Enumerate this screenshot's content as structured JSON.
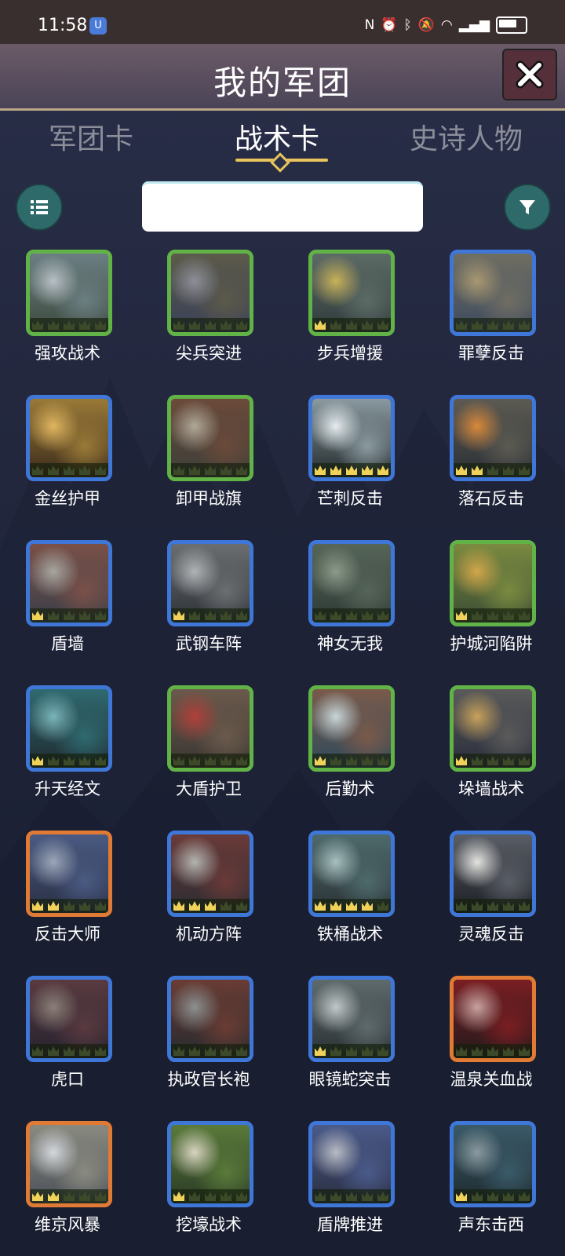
{
  "status": {
    "time": "11:58",
    "app_badge": "U"
  },
  "header": {
    "title": "我的军团"
  },
  "tabs": [
    {
      "label": "军团卡",
      "active": false
    },
    {
      "label": "战术卡",
      "active": true
    },
    {
      "label": "史诗人物",
      "active": false
    }
  ],
  "search": {
    "value": "",
    "placeholder": ""
  },
  "colors": {
    "green": "#62b347",
    "blue": "#3f77d9",
    "orange": "#e07a34",
    "gold": "#e8c45a"
  },
  "cards": [
    {
      "name": "强攻战术",
      "rarity": "green",
      "stars": 0,
      "art": [
        "#3d4b3e",
        "#6b7e82",
        "#b8c0c6"
      ]
    },
    {
      "name": "尖兵突进",
      "rarity": "green",
      "stars": 0,
      "art": [
        "#3a4058",
        "#5c5a4a",
        "#8d8f98"
      ]
    },
    {
      "name": "步兵增援",
      "rarity": "green",
      "stars": 1,
      "art": [
        "#2f3b3c",
        "#5d6b66",
        "#c8b25a"
      ]
    },
    {
      "name": "罪孽反击",
      "rarity": "blue",
      "stars": 0,
      "art": [
        "#3e4a5e",
        "#6f6e63",
        "#a89870"
      ]
    },
    {
      "name": "金丝护甲",
      "rarity": "blue",
      "stars": 0,
      "art": [
        "#3a2a1a",
        "#9a7a38",
        "#e0b660"
      ]
    },
    {
      "name": "卸甲战旗",
      "rarity": "green",
      "stars": 0,
      "art": [
        "#3c3f3a",
        "#6b4a3a",
        "#b0a898"
      ]
    },
    {
      "name": "芒刺反击",
      "rarity": "blue",
      "stars": 5,
      "art": [
        "#222a2c",
        "#8a9aa0",
        "#e6ecef"
      ]
    },
    {
      "name": "落石反击",
      "rarity": "blue",
      "stars": 2,
      "art": [
        "#2b3036",
        "#5c5a52",
        "#d9893a"
      ]
    },
    {
      "name": "盾墙",
      "rarity": "blue",
      "stars": 1,
      "art": [
        "#3a3f48",
        "#7a5048",
        "#a8a6a0"
      ]
    },
    {
      "name": "武钢车阵",
      "rarity": "blue",
      "stars": 1,
      "art": [
        "#2d3238",
        "#6b6e70",
        "#b0b3b6"
      ]
    },
    {
      "name": "神女无我",
      "rarity": "blue",
      "stars": 0,
      "art": [
        "#2e3a36",
        "#566558",
        "#8c9a8a"
      ]
    },
    {
      "name": "护城河陷阱",
      "rarity": "green",
      "stars": 1,
      "art": [
        "#3a4c34",
        "#7a8a40",
        "#d2a64a"
      ]
    },
    {
      "name": "升天经文",
      "rarity": "blue",
      "stars": 1,
      "art": [
        "#1f2a30",
        "#2f6a70",
        "#7ab4b8"
      ]
    },
    {
      "name": "大盾护卫",
      "rarity": "green",
      "stars": 0,
      "art": [
        "#3a3632",
        "#6b5a4c",
        "#b0403a"
      ]
    },
    {
      "name": "后勤术",
      "rarity": "green",
      "stars": 1,
      "art": [
        "#2f4a5c",
        "#7a5a4a",
        "#c8d6d8"
      ]
    },
    {
      "name": "垛墙战术",
      "rarity": "green",
      "stars": 1,
      "art": [
        "#2a2e3c",
        "#5a5a5a",
        "#c8a25a"
      ]
    },
    {
      "name": "反击大师",
      "rarity": "orange",
      "stars": 2,
      "art": [
        "#2a2f44",
        "#4a5a82",
        "#9ca6b8"
      ]
    },
    {
      "name": "机动方阵",
      "rarity": "blue",
      "stars": 3,
      "art": [
        "#2a2c32",
        "#6a3a38",
        "#b4b4b0"
      ]
    },
    {
      "name": "铁桶战术",
      "rarity": "blue",
      "stars": 4,
      "art": [
        "#2a3236",
        "#4e6a6c",
        "#a8c0c0"
      ]
    },
    {
      "name": "灵魂反击",
      "rarity": "blue",
      "stars": 0,
      "art": [
        "#1c1e24",
        "#5a5e66",
        "#e4e4e0"
      ]
    },
    {
      "name": "虎口",
      "rarity": "blue",
      "stars": 0,
      "art": [
        "#24222e",
        "#5a3a40",
        "#8a8078"
      ]
    },
    {
      "name": "执政官长袍",
      "rarity": "blue",
      "stars": 0,
      "art": [
        "#262a2e",
        "#6a3c34",
        "#8c9090"
      ]
    },
    {
      "name": "眼镜蛇突击",
      "rarity": "blue",
      "stars": 1,
      "art": [
        "#2a3034",
        "#5e6a6c",
        "#c2c8c8"
      ]
    },
    {
      "name": "温泉关血战",
      "rarity": "orange",
      "stars": 0,
      "art": [
        "#221a1c",
        "#7a1e22",
        "#c8a2a0"
      ]
    },
    {
      "name": "维京风暴",
      "rarity": "orange",
      "stars": 2,
      "art": [
        "#4a5058",
        "#8a8a80",
        "#d4d8dc"
      ]
    },
    {
      "name": "挖壕战术",
      "rarity": "blue",
      "stars": 1,
      "art": [
        "#2a3a26",
        "#5a7a3a",
        "#d8d4c0"
      ]
    },
    {
      "name": "盾牌推进",
      "rarity": "blue",
      "stars": 0,
      "art": [
        "#2a2e40",
        "#4a5a8a",
        "#b8bcc4"
      ]
    },
    {
      "name": "声东击西",
      "rarity": "blue",
      "stars": 1,
      "art": [
        "#1e2a30",
        "#3a5a68",
        "#8a9aa0"
      ]
    }
  ]
}
